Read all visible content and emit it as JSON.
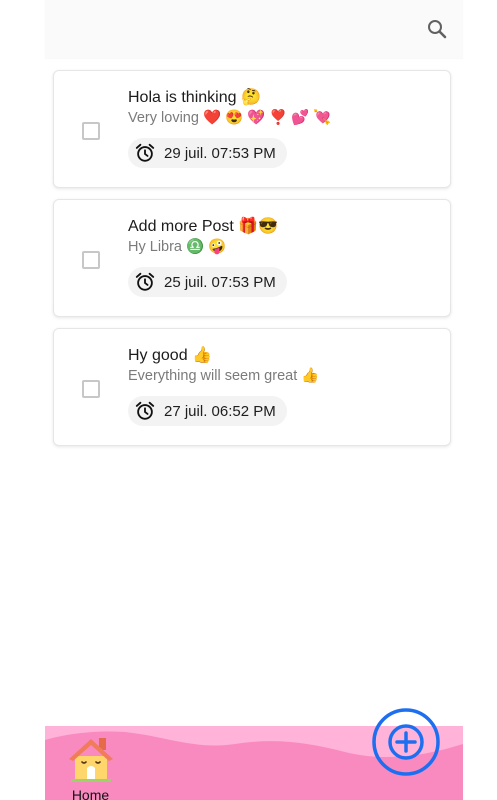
{
  "topbar": {
    "search_icon": "search-icon"
  },
  "tasks": [
    {
      "title": "Hola is thinking 🤔",
      "description": "Very loving ❤️ 😍 💖 ❣️ 💕 💘",
      "reminder": "29 juil. 07:53 PM",
      "checked": false
    },
    {
      "title": "Add more Post 🎁😎",
      "description": "Hy Libra ♎ 🤪",
      "reminder": "25 juil. 07:53 PM",
      "checked": false
    },
    {
      "title": "Hy good 👍",
      "description": "Everything will seem great 👍",
      "reminder": "27 juil. 06:52 PM",
      "checked": false
    }
  ],
  "bottom_nav": {
    "home_label": "Home",
    "home_icon": "house-icon"
  },
  "fab": {
    "icon": "plus-circle-icon"
  },
  "colors": {
    "bottom_bar": "#f98ac0",
    "bottom_wave": "#ffb3d9",
    "fab_accent": "#1e6ff0"
  }
}
